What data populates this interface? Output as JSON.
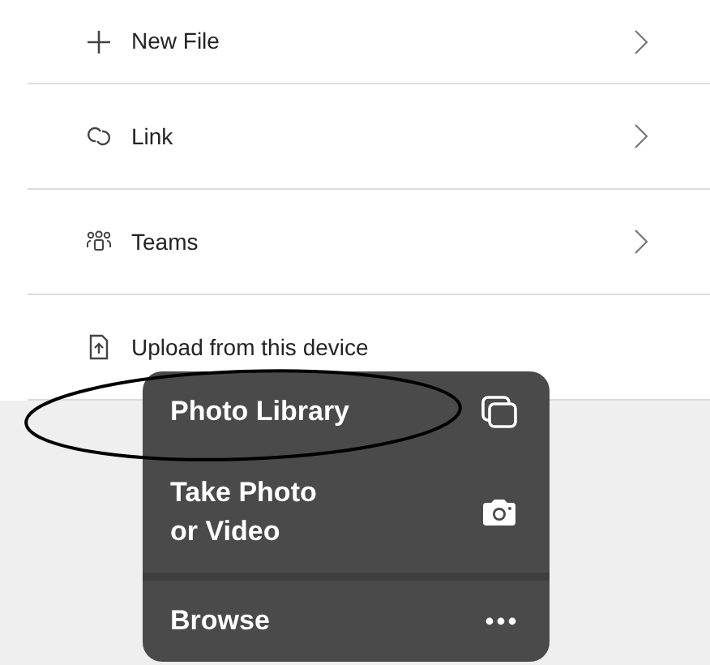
{
  "rows": [
    {
      "label": "New File",
      "chevron": true
    },
    {
      "label": "Link",
      "chevron": true
    },
    {
      "label": "Teams",
      "chevron": true
    },
    {
      "label": "Upload from this device",
      "chevron": false
    }
  ],
  "menu": [
    {
      "label": "Photo Library",
      "separator_before": false
    },
    {
      "label": "Take Photo\nor Video",
      "separator_before": false
    },
    {
      "label": "Browse",
      "separator_before": true
    }
  ]
}
